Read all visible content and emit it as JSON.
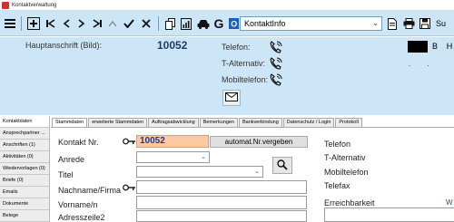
{
  "window": {
    "title": "Kontaktverwaltung"
  },
  "toolbar": {
    "dropdown_value": "KontaktInfo",
    "right_label": "Su"
  },
  "header": {
    "label": "Hauptanschrift (Bild):",
    "number": "10052",
    "phone_labels": [
      "Telefon:",
      "T-Alternativ:",
      "Mobiltelefon:"
    ],
    "format_bold": "B",
    "format_h": "H",
    "dots": ". ."
  },
  "sidebar": {
    "items": [
      "Kontaktdaten",
      "Ansprechpartner ...",
      "Anschriften (1)",
      "Aktivitäten (0)",
      "Wiedervorlagen (0)",
      "Briefe (0)",
      "Emails",
      "Dokumente",
      "Belege"
    ]
  },
  "tabs": [
    "Stammdaten",
    "erweiterte Stammdaten",
    "Auftragsabwicklung",
    "Bemerkungen",
    "Bankverbindung",
    "Datenschutz / Login",
    "Protokoll"
  ],
  "form": {
    "kontakt_nr_label": "Kontakt Nr.",
    "kontakt_nr_value": "10052",
    "generate_button": "automat.Nr.vergeben",
    "anrede_label": "Anrede",
    "titel_label": "Titel",
    "nachname_label": "Nachname/Firma",
    "vorname_label": "Vorname/n",
    "adresszeile_label": "Adresszeile2",
    "right_labels": [
      "Telefon",
      "T-Alternativ",
      "Mobiltelefon",
      "Telefax"
    ],
    "erreichbarkeit_label": "Erreichbarkeit",
    "erreichbarkeit_link": "W"
  },
  "colors": {
    "toolbar_bg": "#cde6f7",
    "kontakt_field_bg": "#fcc9a4",
    "header_number": "#1e3a5c"
  }
}
